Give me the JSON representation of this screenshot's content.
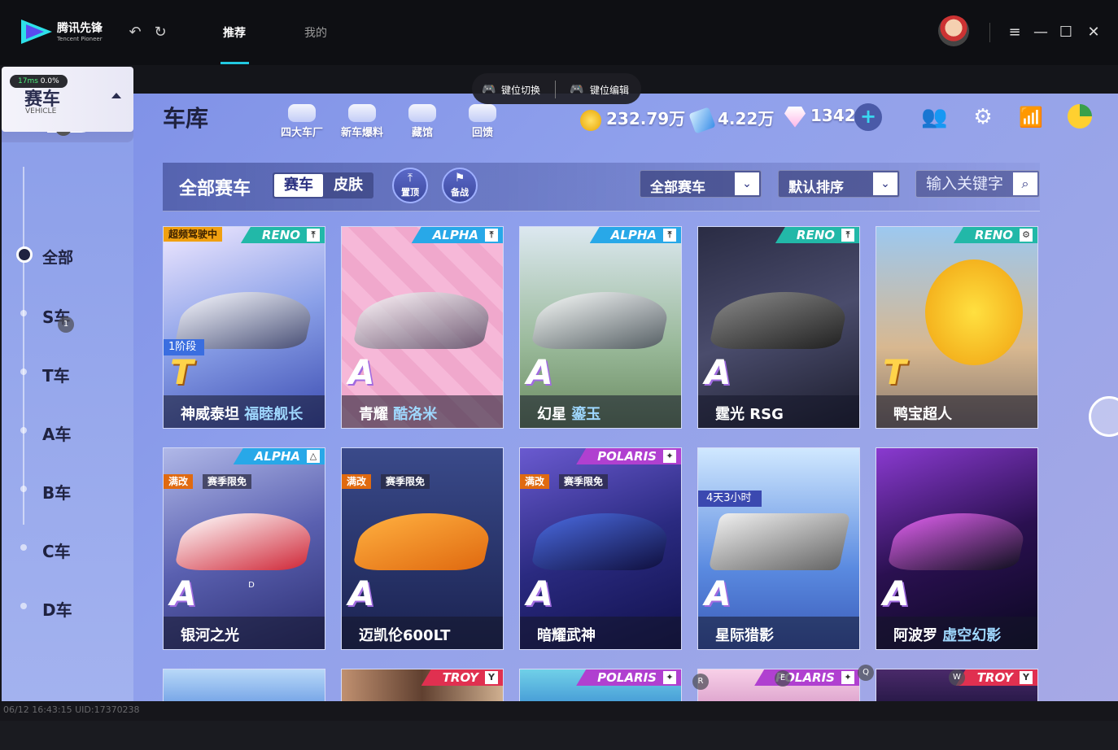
{
  "app": {
    "logo_name": "腾讯先锋",
    "logo_sub": "Tencent Pioneer",
    "tabs": [
      "推荐",
      "我的"
    ],
    "active_tab": "推荐"
  },
  "overlay": {
    "perf_ms": "17ms",
    "perf_loss": "0.0%",
    "key_switch": "键位切换",
    "key_edit": "键位编辑",
    "watermark": "06/12 16:43:15 UID:17370238"
  },
  "game": {
    "sidebar": {
      "vehicle_title": "赛车",
      "vehicle_sub": "VEHICLE",
      "categories": [
        "全部",
        "S车",
        "T车",
        "A车",
        "B车",
        "C车",
        "D车"
      ]
    },
    "header": {
      "title": "车库",
      "nav": [
        "四大车厂",
        "新车爆料",
        "藏馆",
        "回馈"
      ],
      "coins": "232.79万",
      "vouchers": "4.22万",
      "diamonds": "1342"
    },
    "filter": {
      "title": "全部赛车",
      "seg_vehicle": "赛车",
      "seg_skin": "皮肤",
      "pin_top": "置顶",
      "backup": "备战",
      "dropdown_type": "全部赛车",
      "dropdown_sort": "默认排序",
      "search_placeholder": "输入关键字"
    },
    "cards": [
      {
        "name": "神威泰坦",
        "sub": "福睦舰长",
        "grade": "T",
        "brand": "RENO",
        "brand_color": "#22b8a8",
        "tag1": "超频驾驶中",
        "badge": "1阶段"
      },
      {
        "name": "青耀",
        "sub": "酷洛米",
        "grade": "A",
        "brand": "ALPHA",
        "brand_color": "#28a8e8"
      },
      {
        "name": "幻星",
        "sub": "鎏玉",
        "grade": "A",
        "brand": "ALPHA",
        "brand_color": "#28a8e8"
      },
      {
        "name": "霆光 RSG",
        "sub": "",
        "grade": "A",
        "brand": "RENO",
        "brand_color": "#22b8a8"
      },
      {
        "name": "鸭宝超人",
        "sub": "",
        "grade": "T",
        "brand": "RENO",
        "brand_color": "#22b8a8"
      },
      {
        "name": "银河之光",
        "sub": "",
        "grade": "A",
        "brand": "ALPHA",
        "brand_color": "#28a8e8",
        "tag1": "满改",
        "tag2": "赛季限免"
      },
      {
        "name": "迈凯伦600LT",
        "sub": "",
        "grade": "A",
        "brand": "",
        "brand_color": "",
        "tag1": "满改",
        "tag2": "赛季限免"
      },
      {
        "name": "暗耀武神",
        "sub": "",
        "grade": "A",
        "brand": "POLARIS",
        "brand_color": "#b040d0",
        "tag1": "满改",
        "tag2": "赛季限免"
      },
      {
        "name": "星际猎影",
        "sub": "",
        "grade": "A",
        "brand": "",
        "brand_color": "",
        "timer": "4天3小时"
      },
      {
        "name": "阿波罗",
        "sub": "虚空幻影",
        "grade": "A",
        "brand": "",
        "brand_color": ""
      }
    ],
    "row3_brands": [
      "",
      "TROY",
      "POLARIS",
      "POLARIS",
      "TROY"
    ],
    "key_overlays": [
      "1",
      "D",
      "R",
      "E",
      "Q",
      "W"
    ]
  },
  "colors": {
    "accent": "#22c8e0",
    "title_bg": "#0e0f13",
    "game_bg": "#8fa0ec"
  }
}
